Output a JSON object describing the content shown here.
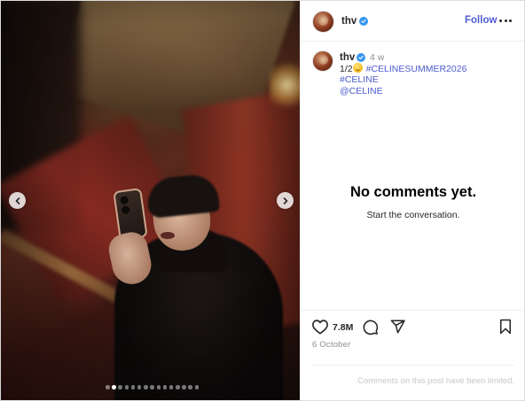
{
  "post": {
    "media": {
      "description_icon": "photo",
      "carousel_count": 15,
      "active_index": 1,
      "prev_icon": "chevron-left-icon",
      "next_icon": "chevron-right-icon"
    },
    "header": {
      "username": "thv",
      "verified": true,
      "follow_label": "Follow",
      "more_icon": "more-horizontal-icon"
    },
    "caption": {
      "username": "thv",
      "time_ago": "4 w",
      "prefix": "1/2",
      "emoji_icon": "smile-emoji",
      "tags": [
        "#CELINESUMMER2026",
        "#CELINE",
        "@CELINE"
      ]
    },
    "comments": {
      "empty_title": "No comments yet.",
      "empty_subtitle": "Start the conversation."
    },
    "actions": {
      "like_icon": "heart-icon",
      "like_count": "7.8M",
      "comment_icon": "comment-icon",
      "share_icon": "share-icon",
      "save_icon": "bookmark-icon",
      "date": "6 October"
    },
    "footer": {
      "limited_text": "Comments on this post have been limited."
    },
    "colors": {
      "link": "#4c5bcf",
      "follow": "#4f5bd5",
      "verified": "#3897f0",
      "muted": "#8e8e8e"
    }
  }
}
